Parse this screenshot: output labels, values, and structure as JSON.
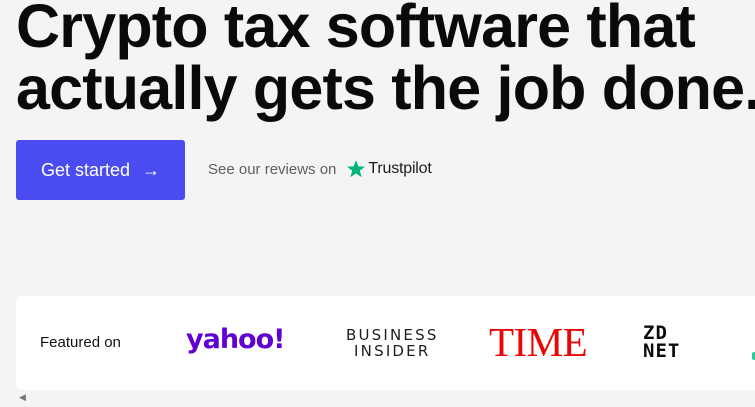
{
  "hero": {
    "title_line1": "Crypto tax software that",
    "title_line2": "actually gets the job done."
  },
  "cta": {
    "label": "Get started",
    "arrow": "→"
  },
  "reviews": {
    "prefix": "See our reviews on",
    "trustpilot": "Trustpilot",
    "star_color": "#00b67a"
  },
  "featured": {
    "label": "Featured on",
    "logos": {
      "yahoo": "yahoo!",
      "business_insider_line1": "BUSINESS",
      "business_insider_line2": "INSIDER",
      "time": "TIME",
      "zdnet_line1": "ZD",
      "zdnet_line2": "NET"
    }
  },
  "colors": {
    "primary": "#4b4bf2",
    "yahoo": "#6001d2",
    "time": "#e90606",
    "background": "#f4f4f4"
  },
  "scroll": {
    "left_arrow": "◀"
  }
}
